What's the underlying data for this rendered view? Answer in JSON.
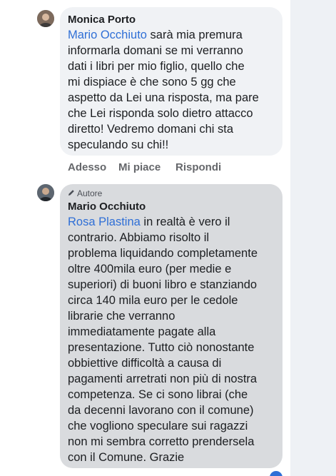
{
  "comment1": {
    "author": "Monica Porto",
    "mention": "Mario Occhiuto",
    "first_line_rest": " sarà mia premura",
    "lines": [
      "informarla domani se mi verranno",
      "dati i libri per mio figlio,  quello che",
      "mi dispiace è che sono 5 gg che",
      "aspetto da Lei una risposta, ma pare",
      "che Lei risponda solo dietro attacco",
      "diretto! Vedremo domani chi sta",
      "speculando su chi!!"
    ]
  },
  "actions": {
    "time": "Adesso",
    "like": "Mi piace",
    "reply": "Rispondi"
  },
  "comment2": {
    "badge": "Autore",
    "author": "Mario Occhiuto",
    "mention": "Rosa Plastina",
    "first_line_rest": " in realtà è vero il",
    "lines": [
      "contrario. Abbiamo risolto il",
      "problema liquidando completamente",
      "oltre 400mila euro (per medie e",
      "superiori) di buoni libro e stanziando",
      "circa 140 mila euro per le cedole",
      "librarie che verranno",
      "immediatamente pagate alla",
      "presentazione. Tutto ciò nonostante",
      "obbiettive difficoltà a causa di",
      "pagamenti arretrati non più di nostra",
      "competenza. Se ci sono librai (che",
      "da decenni lavorano con il comune)",
      "che vogliono speculare sui ragazzi",
      "non mi sembra corretto prendersela",
      "con il Comune. Grazie"
    ]
  },
  "colors": {
    "mention": "#2f6fd6",
    "bubble1": "#f0f2f5",
    "bubble2": "#d9dbde",
    "action_text": "#65676b"
  },
  "icons": {
    "avatar1": "person-avatar",
    "avatar2": "person-avatar",
    "badge": "pencil-icon"
  }
}
